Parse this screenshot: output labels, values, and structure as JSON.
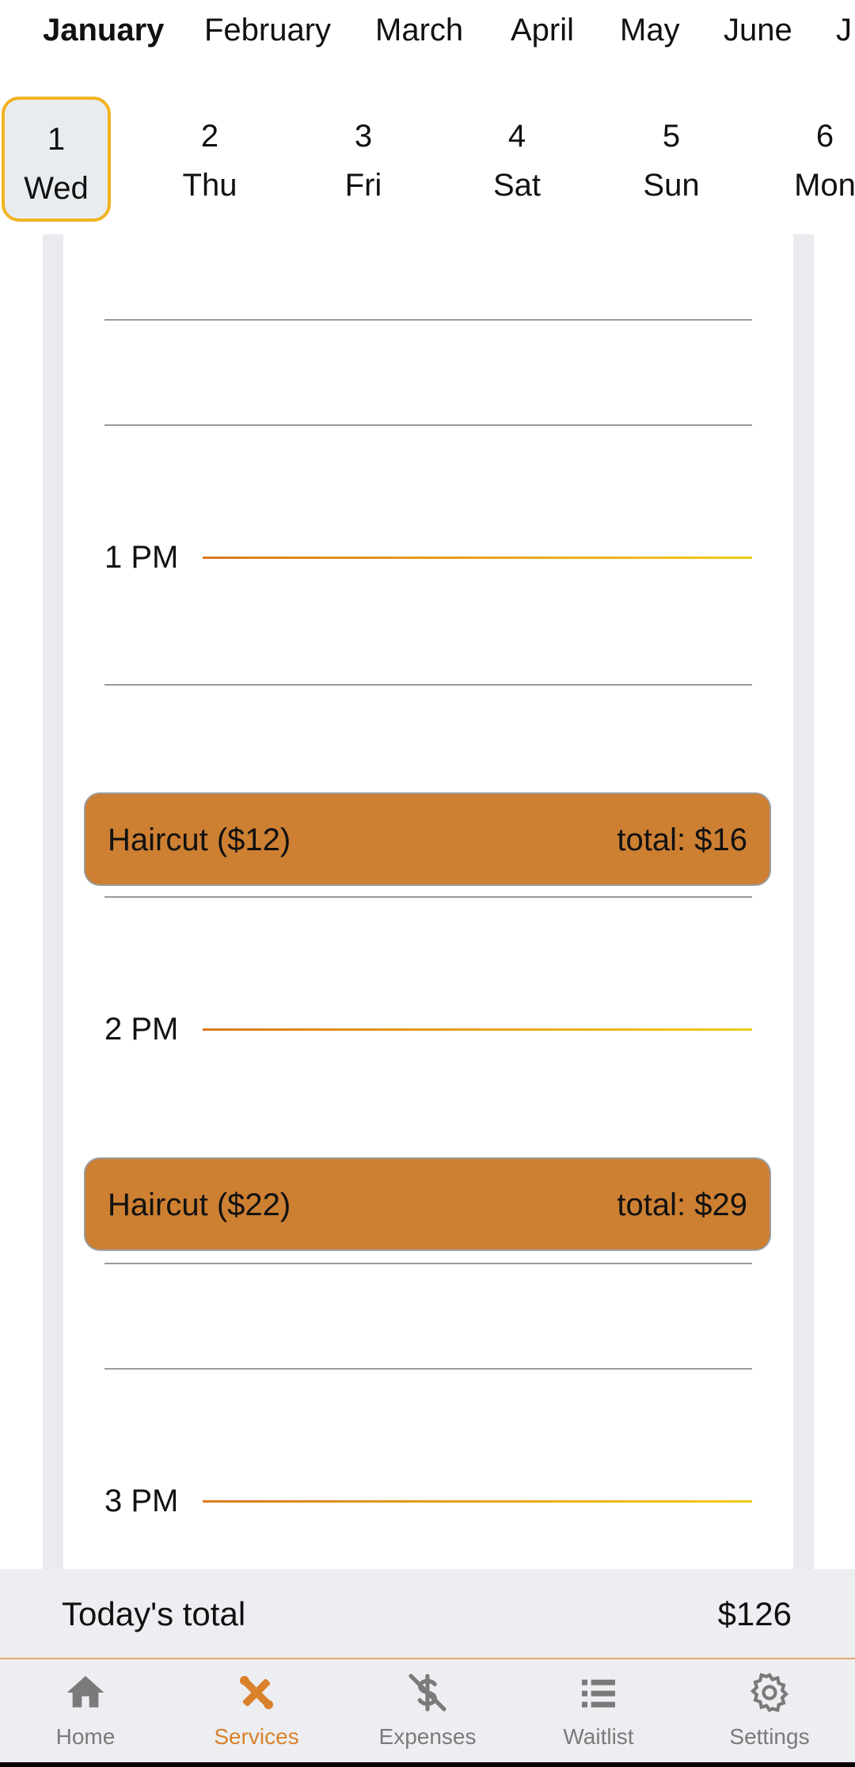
{
  "months": [
    "January",
    "February",
    "March",
    "April",
    "May",
    "June",
    "J"
  ],
  "active_month": "January",
  "days": [
    {
      "num": "1",
      "weekday": "Wed",
      "selected": true
    },
    {
      "num": "2",
      "weekday": "Thu"
    },
    {
      "num": "3",
      "weekday": "Fri"
    },
    {
      "num": "4",
      "weekday": "Sat"
    },
    {
      "num": "5",
      "weekday": "Sun"
    },
    {
      "num": "6",
      "weekday": "Mon"
    }
  ],
  "timeline": {
    "hours": [
      "1 PM",
      "2 PM",
      "3 PM"
    ],
    "appointments": [
      {
        "service": "Haircut ($12)",
        "total": "total: $16"
      },
      {
        "service": "Haircut ($22)",
        "total": "total: $29"
      }
    ]
  },
  "summary": {
    "label": "Today's total",
    "amount": "$126"
  },
  "nav": [
    {
      "label": "Home",
      "icon": "home-icon"
    },
    {
      "label": "Services",
      "icon": "scissors-ruler-icon",
      "active": true
    },
    {
      "label": "Expenses",
      "icon": "no-dollar-icon"
    },
    {
      "label": "Waitlist",
      "icon": "list-icon"
    },
    {
      "label": "Settings",
      "icon": "gear-icon"
    }
  ],
  "colors": {
    "accent": "#cd7f32",
    "selected_border": "#f0b323",
    "nav_active": "#d9822b",
    "nav_inactive": "#7a7a7a"
  }
}
